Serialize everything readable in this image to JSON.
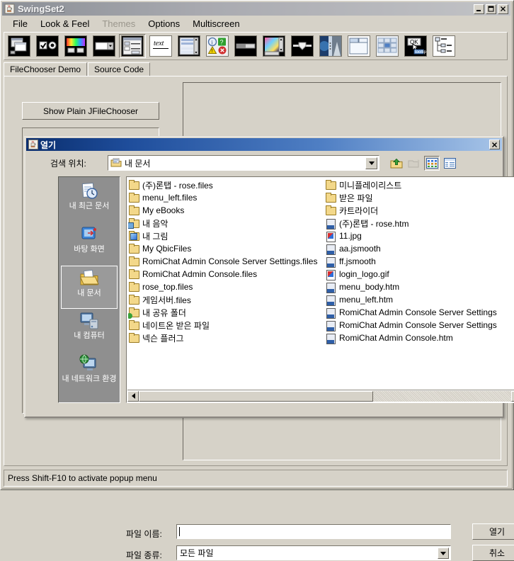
{
  "window": {
    "title": "SwingSet2",
    "icon": "java-coffee-cup-icon",
    "buttons": {
      "minimize": "_",
      "maximize": "❐",
      "close": "✕"
    }
  },
  "menubar": {
    "items": [
      {
        "label": "File",
        "disabled": false
      },
      {
        "label": "Look & Feel",
        "disabled": false
      },
      {
        "label": "Themes",
        "disabled": true
      },
      {
        "label": "Options",
        "disabled": false
      },
      {
        "label": "Multiscreen",
        "disabled": false
      }
    ]
  },
  "toolbar": {
    "buttons": [
      {
        "name": "internal-frame-demo",
        "selected": false
      },
      {
        "name": "button-demo",
        "selected": false
      },
      {
        "name": "colorchooser-demo",
        "selected": false
      },
      {
        "name": "combobox-demo",
        "selected": false
      },
      {
        "name": "filechooser-demo",
        "selected": true
      },
      {
        "name": "editorpane-demo",
        "selected": false
      },
      {
        "name": "list-demo",
        "selected": false
      },
      {
        "name": "optionpane-demo",
        "selected": false
      },
      {
        "name": "progressbar-demo",
        "selected": false
      },
      {
        "name": "scrollpane-demo",
        "selected": false
      },
      {
        "name": "slider-demo",
        "selected": false
      },
      {
        "name": "splitpane-demo",
        "selected": false
      },
      {
        "name": "tabbedpane-demo",
        "selected": false
      },
      {
        "name": "table-demo",
        "selected": false
      },
      {
        "name": "tooltip-demo",
        "selected": false
      },
      {
        "name": "tree-demo",
        "selected": false
      }
    ]
  },
  "tabs": [
    {
      "label": "FileChooser Demo",
      "active": true
    },
    {
      "label": "Source Code",
      "active": false
    }
  ],
  "demo_panel": {
    "show_plain_button": "Show Plain JFileChooser"
  },
  "statusbar": {
    "text": "Press Shift-F10 to activate popup menu"
  },
  "dialog": {
    "title": "열기",
    "icon": "java-coffee-cup-icon",
    "close_label": "✕",
    "lookin_label": "검색 위치:",
    "lookin_value": "내 문서",
    "lookin_icon": "my-documents-folder-icon",
    "toolbuttons": [
      {
        "name": "up-one-level-icon",
        "selected": false,
        "disabled": false
      },
      {
        "name": "new-folder-icon",
        "selected": false,
        "disabled": true
      },
      {
        "name": "list-view-icon",
        "selected": true,
        "disabled": false
      },
      {
        "name": "details-view-icon",
        "selected": false,
        "disabled": false
      }
    ],
    "shortcuts": [
      {
        "label": "내 최근 문서",
        "icon": "recent-documents-icon",
        "selected": false
      },
      {
        "label": "바탕 화면",
        "icon": "desktop-icon",
        "selected": false
      },
      {
        "label": "내 문서",
        "icon": "my-documents-icon",
        "selected": true
      },
      {
        "label": "내 컴퓨터",
        "icon": "my-computer-icon",
        "selected": false
      },
      {
        "label": "내 네트워크 환경",
        "icon": "my-network-places-icon",
        "selected": false
      }
    ],
    "files": {
      "column1": [
        {
          "name": "(주)론탭 - rose.files",
          "icon": "folder-icon"
        },
        {
          "name": "menu_left.files",
          "icon": "folder-icon"
        },
        {
          "name": "My eBooks",
          "icon": "folder-icon"
        },
        {
          "name": "내 음악",
          "icon": "my-music-folder-icon"
        },
        {
          "name": "내 그림",
          "icon": "my-pictures-folder-icon"
        },
        {
          "name": "My QbicFiles",
          "icon": "folder-icon"
        },
        {
          "name": "RomiChat Admin Console Server Settings.files",
          "icon": "folder-icon"
        },
        {
          "name": "RomiChat Admin Console.files",
          "icon": "folder-icon"
        },
        {
          "name": "rose_top.files",
          "icon": "folder-icon"
        },
        {
          "name": "게임서버.files",
          "icon": "folder-icon"
        },
        {
          "name": "내 공유 폴더",
          "icon": "shared-folder-icon"
        },
        {
          "name": "네이트온 받은 파일",
          "icon": "folder-icon"
        },
        {
          "name": "넥슨 플러그",
          "icon": "folder-icon"
        }
      ],
      "column2": [
        {
          "name": "미니플레이리스트",
          "icon": "folder-icon"
        },
        {
          "name": "받은 파일",
          "icon": "folder-icon"
        },
        {
          "name": "카트라이더",
          "icon": "folder-icon"
        },
        {
          "name": "(주)론탭 - rose.htm",
          "icon": "html-file-icon"
        },
        {
          "name": "11.jpg",
          "icon": "image-file-icon"
        },
        {
          "name": "aa.jsmooth",
          "icon": "html-file-icon"
        },
        {
          "name": "ff.jsmooth",
          "icon": "html-file-icon"
        },
        {
          "name": "login_logo.gif",
          "icon": "image-file-icon"
        },
        {
          "name": "menu_body.htm",
          "icon": "html-file-icon"
        },
        {
          "name": "menu_left.htm",
          "icon": "html-file-icon"
        },
        {
          "name": "RomiChat Admin Console Server Settings",
          "icon": "html-file-icon"
        },
        {
          "name": "RomiChat Admin Console Server Settings",
          "icon": "html-file-icon"
        },
        {
          "name": "RomiChat Admin Console.htm",
          "icon": "html-file-icon"
        }
      ]
    },
    "filename_label": "파일 이름:",
    "filename_value": "",
    "filetype_label": "파일 종류:",
    "filetype_value": "모든 파일",
    "open_button": "열기",
    "cancel_button": "취소"
  },
  "colors": {
    "face": "#d6d2c8",
    "dialog_title_start": "#0a2e6e",
    "dialog_title_end": "#a8c5e8",
    "shortcut_panel": "#8f8f8f",
    "folder_yellow": "#f3d88a"
  }
}
